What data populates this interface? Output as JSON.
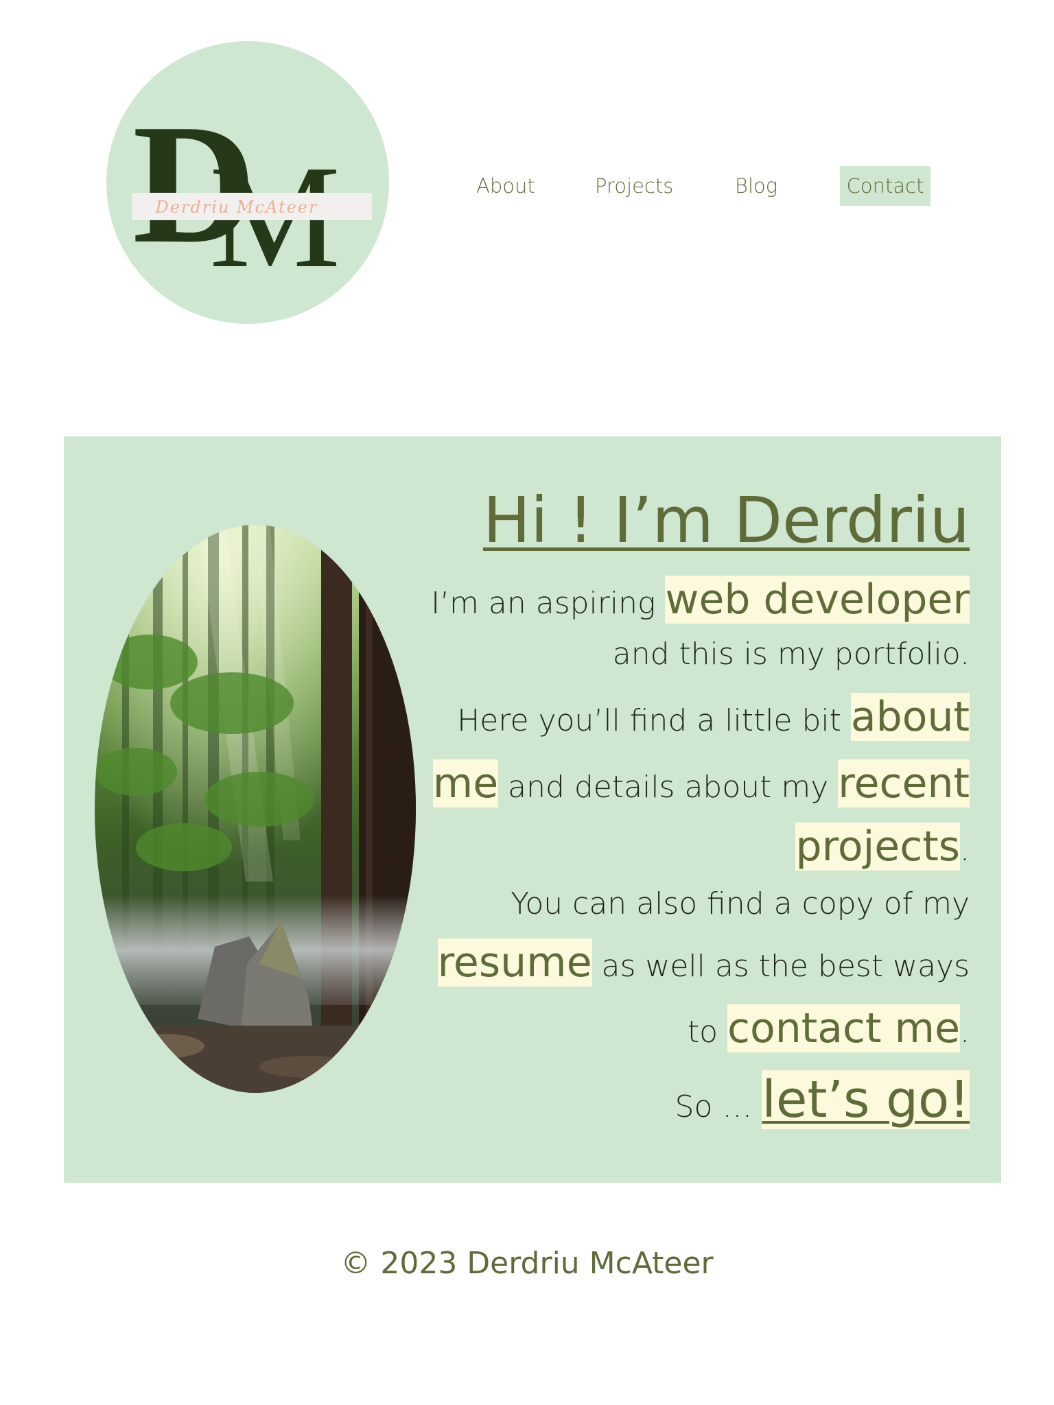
{
  "brand": {
    "monogram_first": "D",
    "monogram_second": "M",
    "signature": "Derdriu McAteer"
  },
  "nav": {
    "items": [
      {
        "label": "About"
      },
      {
        "label": "Projects"
      },
      {
        "label": "Blog"
      },
      {
        "label": "Contact"
      }
    ]
  },
  "hero": {
    "title": "Hi ! I’m Derdriu",
    "text_1": "I’m an aspiring ",
    "link_web_developer": "web developer",
    "text_2": "and this is my portfolio.",
    "text_3": "Here you’ll find a little bit ",
    "link_about_me_part1": "about",
    "link_about_me_part2": "me",
    "text_4": " and details about my ",
    "link_recent_projects_part1": "recent",
    "link_recent_projects_part2": "projects",
    "period": ".",
    "text_5": "You can also find a copy of my",
    "link_resume": "resume",
    "text_6": " as well as the best ways",
    "text_7": "to ",
    "link_contact_me": "contact me",
    "text_8": "So … ",
    "link_lets_go": "let’s go!"
  },
  "footer": {
    "copyright": "© 2023 Derdriu McAteer"
  },
  "colors": {
    "accent_bg": "#cfe6d0",
    "text_olive": "#5f6c3a",
    "highlight": "#fdf9dd",
    "monogram": "#26381a",
    "signature": "#e9b093"
  }
}
